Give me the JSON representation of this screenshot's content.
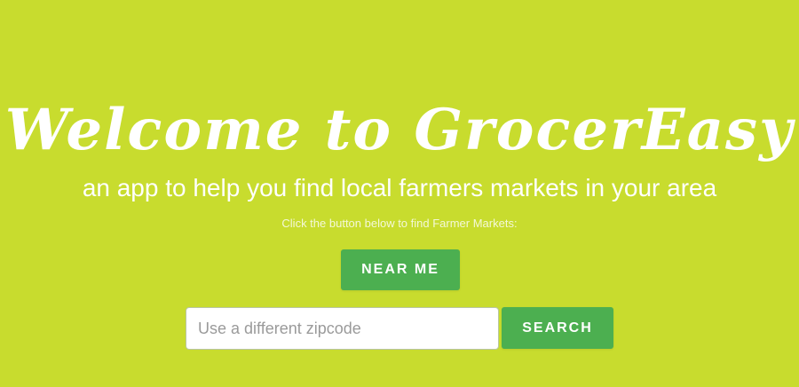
{
  "hero": {
    "title": "Welcome to GrocerEasy",
    "subtitle": "an app to help you find local farmers markets in your area",
    "instruction": "Click the button below to find Farmer Markets:"
  },
  "actions": {
    "near_me_label": "NEAR ME",
    "search_label": "SEARCH"
  },
  "zipcode": {
    "value": "",
    "placeholder": "Use a different zipcode"
  },
  "colors": {
    "background": "#c8dc2e",
    "button": "#4caf50",
    "text": "#ffffff"
  }
}
